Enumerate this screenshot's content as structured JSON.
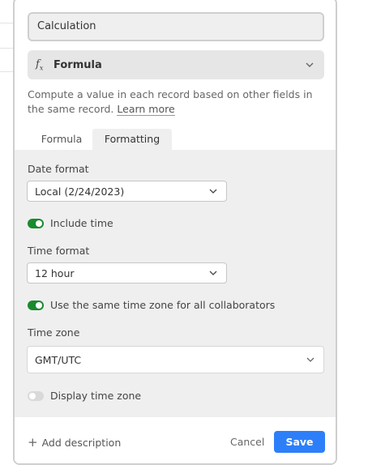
{
  "field": {
    "name_value": "Calculation",
    "type_icon": "fx-icon",
    "type_label": "Formula",
    "description": "Compute a value in each record based on other fields in the same record.",
    "learn_more": "Learn more"
  },
  "tabs": [
    {
      "label": "Formula",
      "active": false
    },
    {
      "label": "Formatting",
      "active": true
    }
  ],
  "formatting": {
    "date_format_label": "Date format",
    "date_format_value": "Local (2/24/2023)",
    "include_time_label": "Include time",
    "include_time_on": true,
    "time_format_label": "Time format",
    "time_format_value": "12 hour",
    "same_tz_label": "Use the same time zone for all collaborators",
    "same_tz_on": true,
    "time_zone_label": "Time zone",
    "time_zone_value": "GMT/UTC",
    "display_tz_label": "Display time zone",
    "display_tz_on": false
  },
  "footer": {
    "add_description": "Add description",
    "cancel": "Cancel",
    "save": "Save"
  },
  "colors": {
    "toggle_on": "#1a8a2e",
    "save_button": "#2d7ff9"
  }
}
